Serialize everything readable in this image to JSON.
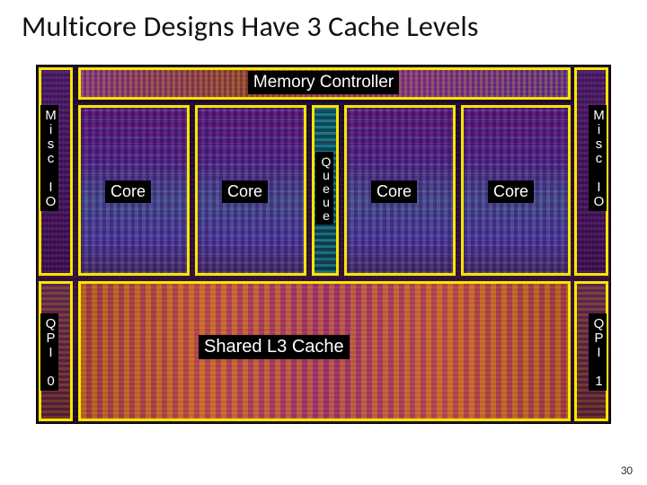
{
  "title": "Multicore Designs Have 3 Cache Levels",
  "labels": {
    "memory_controller": "Memory Controller",
    "core": "Core",
    "queue": "Queue",
    "l3": "Shared L3 Cache",
    "misc_io_left": "Misc\nIO",
    "misc_io_right": "Misc\nIO",
    "qpi0": "QPI\n0",
    "qpi1": "QPI\n1"
  },
  "page_number": "30",
  "colors": {
    "outline": "#f6e600"
  }
}
